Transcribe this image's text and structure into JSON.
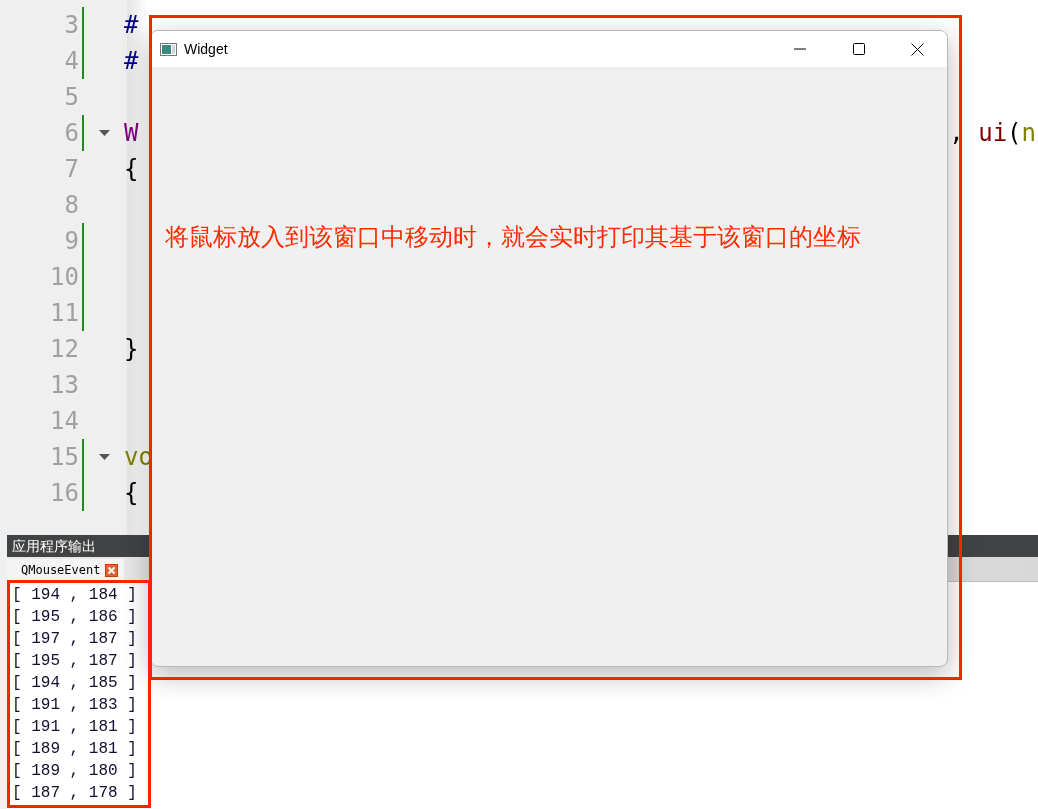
{
  "editor": {
    "lines": [
      {
        "number": "3",
        "changed": true,
        "foldable": false,
        "segments": [
          {
            "text": "#",
            "kind": "preprocessor"
          }
        ]
      },
      {
        "number": "4",
        "changed": true,
        "foldable": false,
        "segments": [
          {
            "text": "#",
            "kind": "preprocessor"
          }
        ]
      },
      {
        "number": "5",
        "changed": false,
        "foldable": false
      },
      {
        "number": "6",
        "changed": true,
        "foldable": true,
        "segments": [
          {
            "text": "W",
            "kind": "type"
          }
        ],
        "right": [
          {
            "text": ", ",
            "kind": "plain"
          },
          {
            "text": "ui",
            "kind": "member"
          },
          {
            "text": "(",
            "kind": "plain"
          },
          {
            "text": "n",
            "kind": "param"
          }
        ]
      },
      {
        "number": "7",
        "changed": false,
        "foldable": false,
        "segments": [
          {
            "text": "{",
            "kind": "plain"
          }
        ]
      },
      {
        "number": "8",
        "changed": false,
        "foldable": false
      },
      {
        "number": "9",
        "changed": true,
        "foldable": false
      },
      {
        "number": "10",
        "changed": true,
        "foldable": false
      },
      {
        "number": "11",
        "changed": true,
        "foldable": false
      },
      {
        "number": "12",
        "changed": false,
        "foldable": false,
        "segments": [
          {
            "text": "}",
            "kind": "plain"
          }
        ]
      },
      {
        "number": "13",
        "changed": false,
        "foldable": false
      },
      {
        "number": "14",
        "changed": false,
        "foldable": false
      },
      {
        "number": "15",
        "changed": true,
        "foldable": true,
        "segments": [
          {
            "text": "vo",
            "kind": "keyword"
          }
        ]
      },
      {
        "number": "16",
        "changed": true,
        "foldable": false,
        "segments": [
          {
            "text": "{",
            "kind": "plain"
          }
        ]
      }
    ]
  },
  "output_pane": {
    "title": "应用程序输出",
    "tabs": [
      {
        "label": "QMouseEvent",
        "selected": true
      }
    ],
    "lines": [
      "[ 194 , 184 ]",
      "[ 195 , 186 ]",
      "[ 197 , 187 ]",
      "[ 195 , 187 ]",
      "[ 194 , 185 ]",
      "[ 191 , 183 ]",
      "[ 191 , 181 ]",
      "[ 189 , 181 ]",
      "[ 189 , 180 ]",
      "[ 187 , 178 ]"
    ]
  },
  "widget_window": {
    "title": "Widget",
    "message": "将鼠标放入到该窗口中移动时，就会实时打印其基于该窗口的坐标"
  }
}
